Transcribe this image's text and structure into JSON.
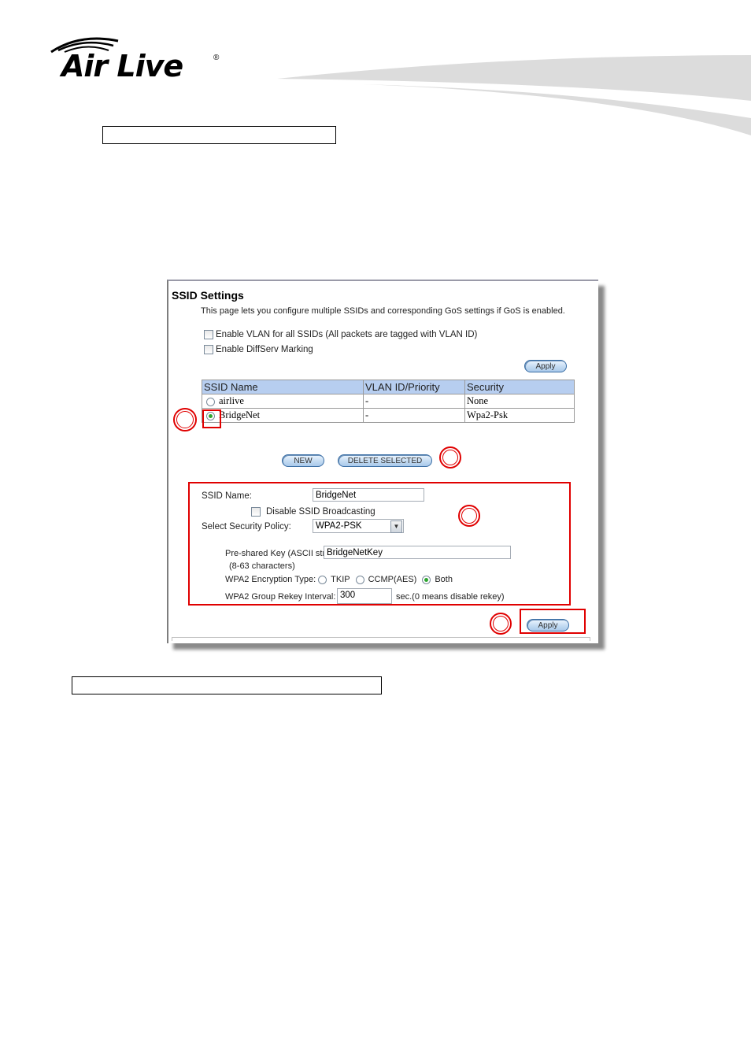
{
  "header": {
    "logo_text": "Air Live",
    "logo_mark": "®"
  },
  "captions": {
    "top": "",
    "bottom": ""
  },
  "ssid_settings": {
    "title": "SSID Settings",
    "description": "This page lets you configure multiple SSIDs and corresponding GoS settings if GoS is enabled.",
    "options": [
      {
        "label": "Enable VLAN for all SSIDs (All packets are tagged with VLAN ID)",
        "checked": false
      },
      {
        "label": "Enable DiffServ Marking",
        "checked": false
      }
    ],
    "apply_top_label": "Apply",
    "table": {
      "columns": [
        "SSID  Name",
        "VLAN ID/Priority",
        "Security"
      ],
      "rows": [
        {
          "name": "airlive",
          "vlan": "-",
          "security": "None",
          "selected": false
        },
        {
          "name": "BridgeNet",
          "vlan": "-",
          "security": "Wpa2-Psk",
          "selected": true
        }
      ]
    },
    "new_label": "NEW",
    "delete_label": "DELETE SELECTED",
    "form": {
      "ssid_name_label": "SSID Name:",
      "ssid_name_value": "BridgeNet",
      "disable_broadcast_label": "Disable SSID Broadcasting",
      "disable_broadcast_checked": false,
      "security_policy_label": "Select Security Policy:",
      "security_policy_value": "WPA2-PSK",
      "psk_label": "Pre-shared Key (ASCII string):",
      "psk_value": "BridgeNetKey",
      "psk_hint": "(8-63 characters)",
      "enc_type_label": "WPA2 Encryption Type:",
      "enc_options": [
        "TKIP",
        "CCMP(AES)",
        "Both"
      ],
      "enc_selected": "Both",
      "rekey_label": "WPA2 Group Rekey Interval:",
      "rekey_value": "300",
      "rekey_hint": "sec.(0 means disable rekey)"
    },
    "apply_bottom_label": "Apply"
  },
  "colors": {
    "annotation_red": "#e00000",
    "table_header": "#b7cef0",
    "radio_selected": "#2da530"
  }
}
